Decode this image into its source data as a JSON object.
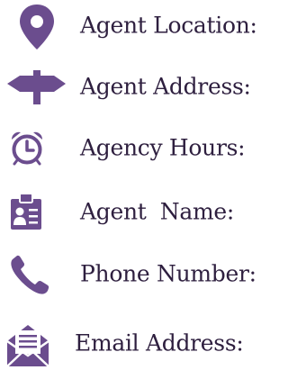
{
  "colors": {
    "icon": "#6b4d8e",
    "text": "#2e1f3f",
    "background": "#ffffff"
  },
  "rows": [
    {
      "icon": "location-pin-icon",
      "label": "Agent Location:"
    },
    {
      "icon": "signpost-icon",
      "label": "Agent Address:"
    },
    {
      "icon": "alarm-clock-icon",
      "label": "Agency Hours:"
    },
    {
      "icon": "id-card-icon",
      "label": "Agent  Name:"
    },
    {
      "icon": "phone-icon",
      "label": "Phone Number:"
    },
    {
      "icon": "envelope-letter-icon",
      "label": "Email Address:"
    }
  ]
}
